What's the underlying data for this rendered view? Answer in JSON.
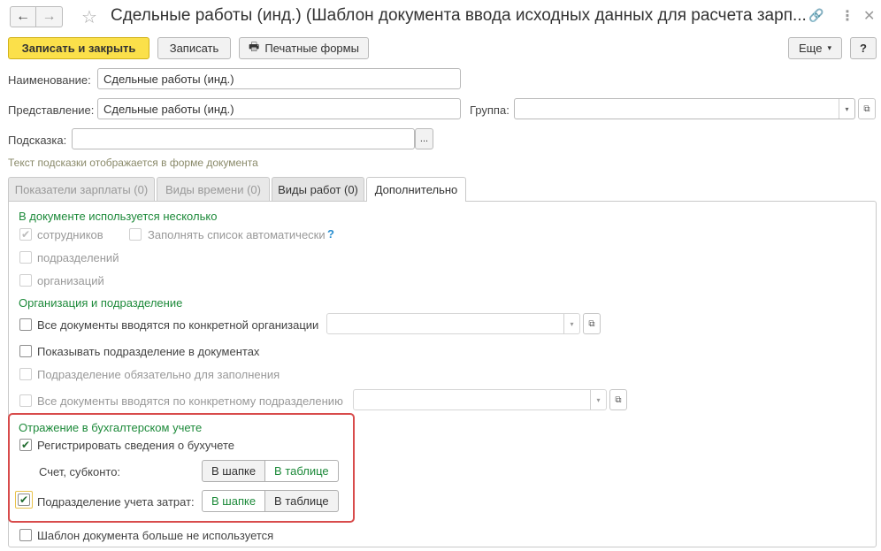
{
  "window": {
    "title": "Сдельные работы (инд.) (Шаблон документа ввода исходных данных для расчета зарп..."
  },
  "toolbar": {
    "save_close": "Записать и закрыть",
    "save": "Записать",
    "print": "Печатные формы",
    "more": "Еще",
    "help": "?"
  },
  "form": {
    "name_label": "Наименование:",
    "name_value": "Сдельные работы (инд.)",
    "repr_label": "Представление:",
    "repr_value": "Сдельные работы (инд.)",
    "group_label": "Группа:",
    "group_value": "",
    "hint_label": "Подсказка:",
    "hint_value": "",
    "hint_button": "...",
    "hint_note": "Текст подсказки отображается в форме документа"
  },
  "tabs": [
    {
      "label": "Показатели зарплаты (0)"
    },
    {
      "label": "Виды времени (0)"
    },
    {
      "label": "Виды работ (0)"
    },
    {
      "label": "Дополнительно"
    }
  ],
  "extra": {
    "sec1": "В документе используется несколько",
    "employees": "сотрудников",
    "autofill": "Заполнять список автоматически",
    "autofill_help": "?",
    "departments": "подразделений",
    "orgs": "организаций",
    "sec2": "Организация и подразделение",
    "all_docs_org": "Все документы вводятся по конкретной организации",
    "show_dept": "Показывать подразделение в документах",
    "dept_required": "Подразделение обязательно для заполнения",
    "all_docs_dept": "Все документы вводятся по конкретному подразделению",
    "sec3": "Отражение в бухгалтерском учете",
    "register_acc": "Регистрировать сведения о бухучете",
    "account_label": "Счет, субконто:",
    "in_header": "В шапке",
    "in_table": "В таблице",
    "cost_dept_label": "Подразделение учета затрат:",
    "not_used": "Шаблон документа больше не используется",
    "checked_mark": "✔"
  },
  "icons": {
    "back": "←",
    "forward": "→",
    "star": "☆",
    "link": "🔗",
    "menu": "⋮",
    "close": "✕",
    "print": "🖶",
    "dropdown": "▾",
    "open": "⧉"
  }
}
